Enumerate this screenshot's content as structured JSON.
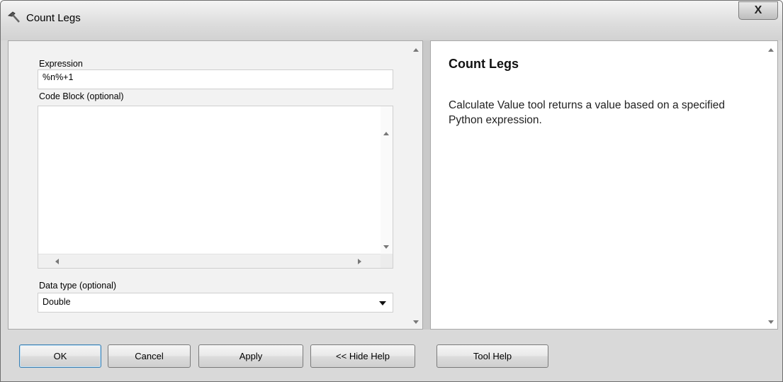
{
  "window": {
    "title": "Count Legs",
    "close_label": "X"
  },
  "form": {
    "expression": {
      "label": "Expression",
      "value": "%n%+1"
    },
    "code_block": {
      "label": "Code Block (optional)",
      "value": ""
    },
    "data_type": {
      "label": "Data type (optional)",
      "value": "Double"
    }
  },
  "help": {
    "title": "Count Legs",
    "body": "Calculate Value tool returns a value based on a specified Python expression."
  },
  "buttons": {
    "ok": "OK",
    "cancel": "Cancel",
    "apply": "Apply",
    "hide_help": "<< Hide Help",
    "tool_help": "Tool Help"
  },
  "icons": {
    "title": "hammer-icon",
    "close": "close-icon"
  }
}
